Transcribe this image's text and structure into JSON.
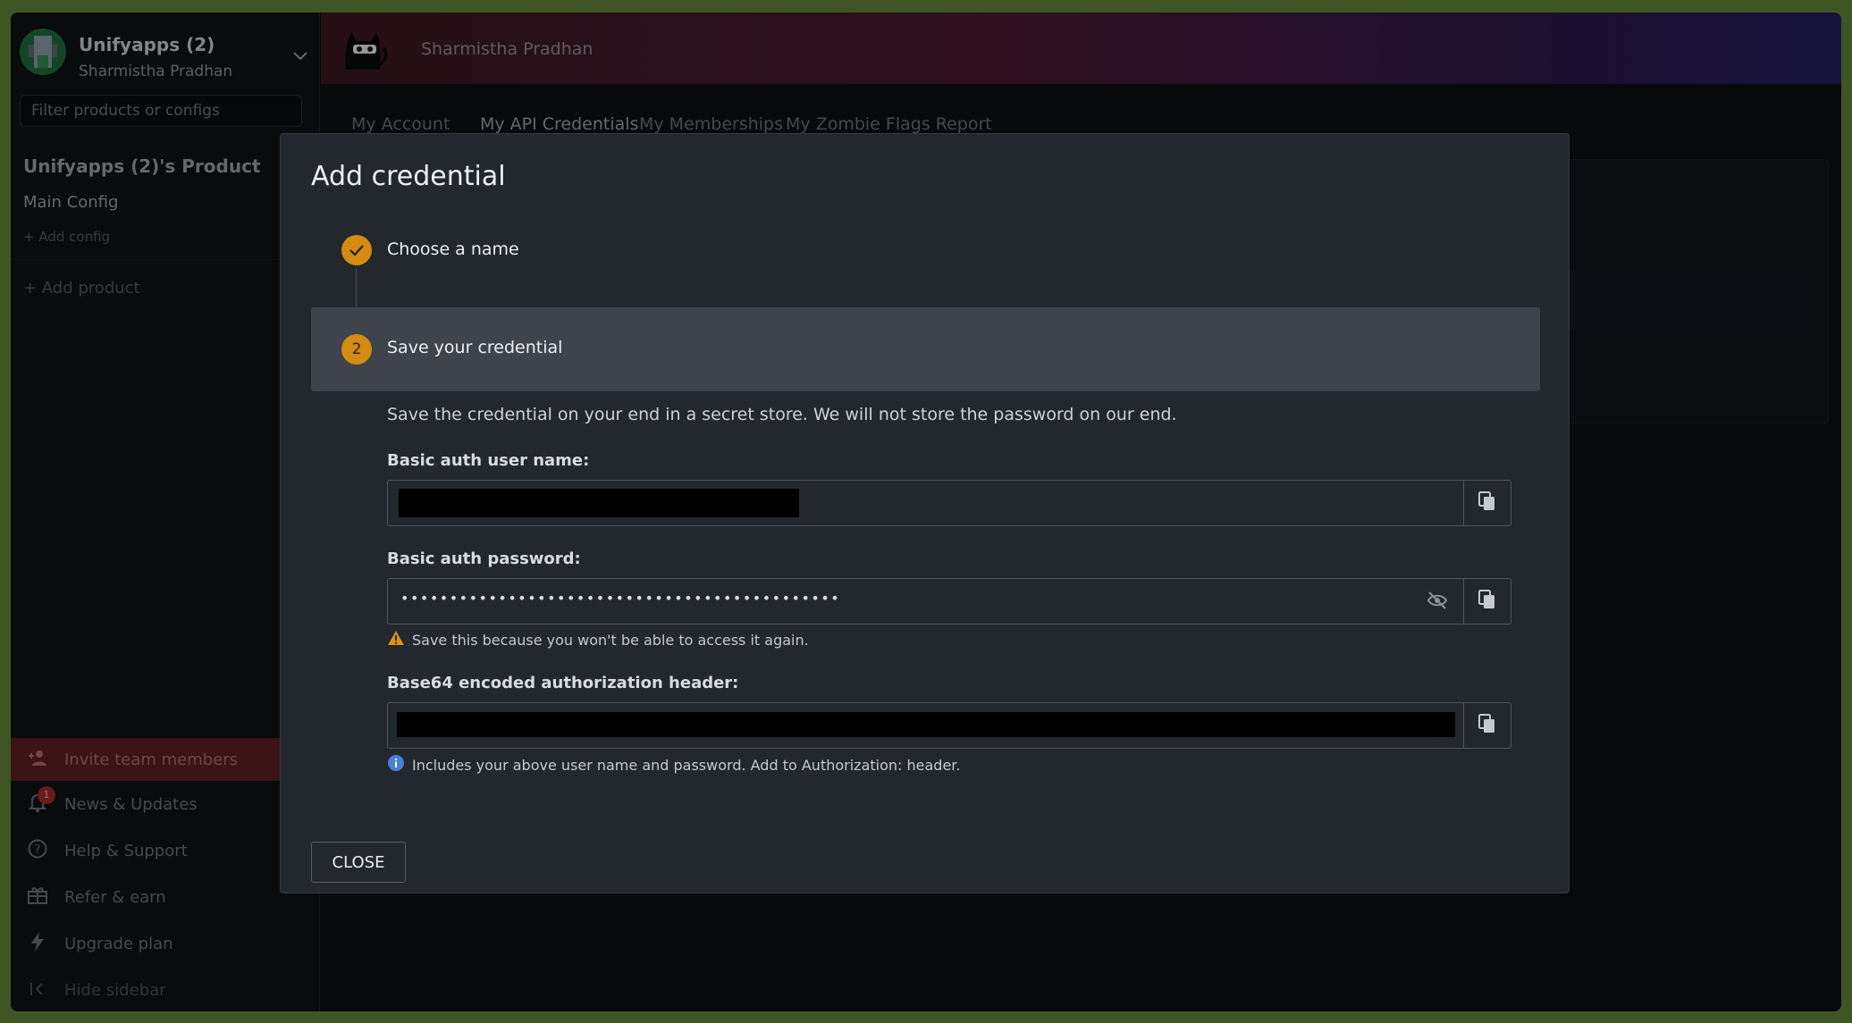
{
  "sidebar": {
    "org_name": "Unifyapps (2)",
    "org_user": "Sharmistha Pradhan",
    "filter_placeholder": "Filter products or configs",
    "product_title": "Unifyapps (2)'s Product",
    "config_name": "Main Config",
    "add_config": "+ Add config",
    "add_product": "+ Add product",
    "nav": [
      {
        "label": "Invite team members",
        "icon": "person-add-icon"
      },
      {
        "label": "News & Updates",
        "icon": "bell-icon",
        "badge": "1"
      },
      {
        "label": "Help & Support",
        "icon": "help-icon"
      },
      {
        "label": "Refer & earn",
        "icon": "gift-icon"
      },
      {
        "label": "Upgrade plan",
        "icon": "bolt-icon"
      },
      {
        "label": "Hide sidebar",
        "icon": "collapse-icon"
      }
    ]
  },
  "header": {
    "user_name": "Sharmistha Pradhan",
    "tabs": [
      "My Account",
      "My API Credentials",
      "My Memberships",
      "My Zombie Flags Report"
    ],
    "active_tab": "My API Credentials"
  },
  "modal": {
    "title": "Add credential",
    "step1": "Choose a name",
    "step2_number": "2",
    "step2": "Save your credential",
    "description": "Save the credential on your end in a secret store. We will not store the password on our end.",
    "username_label": "Basic auth user name:",
    "password_label": "Basic auth password:",
    "password_masked": "•••••••••••••••••••••••••••••••••••••••••••••",
    "password_warning": "Save this because you won't be able to access it again.",
    "header_label": "Base64 encoded authorization header:",
    "header_hint": "Includes your above user name and password. Add to Authorization: header.",
    "close_label": "CLOSE"
  },
  "colors": {
    "accent": "#d58a12",
    "modal_bg": "#23272e",
    "invite_bg": "#5a1f22"
  }
}
